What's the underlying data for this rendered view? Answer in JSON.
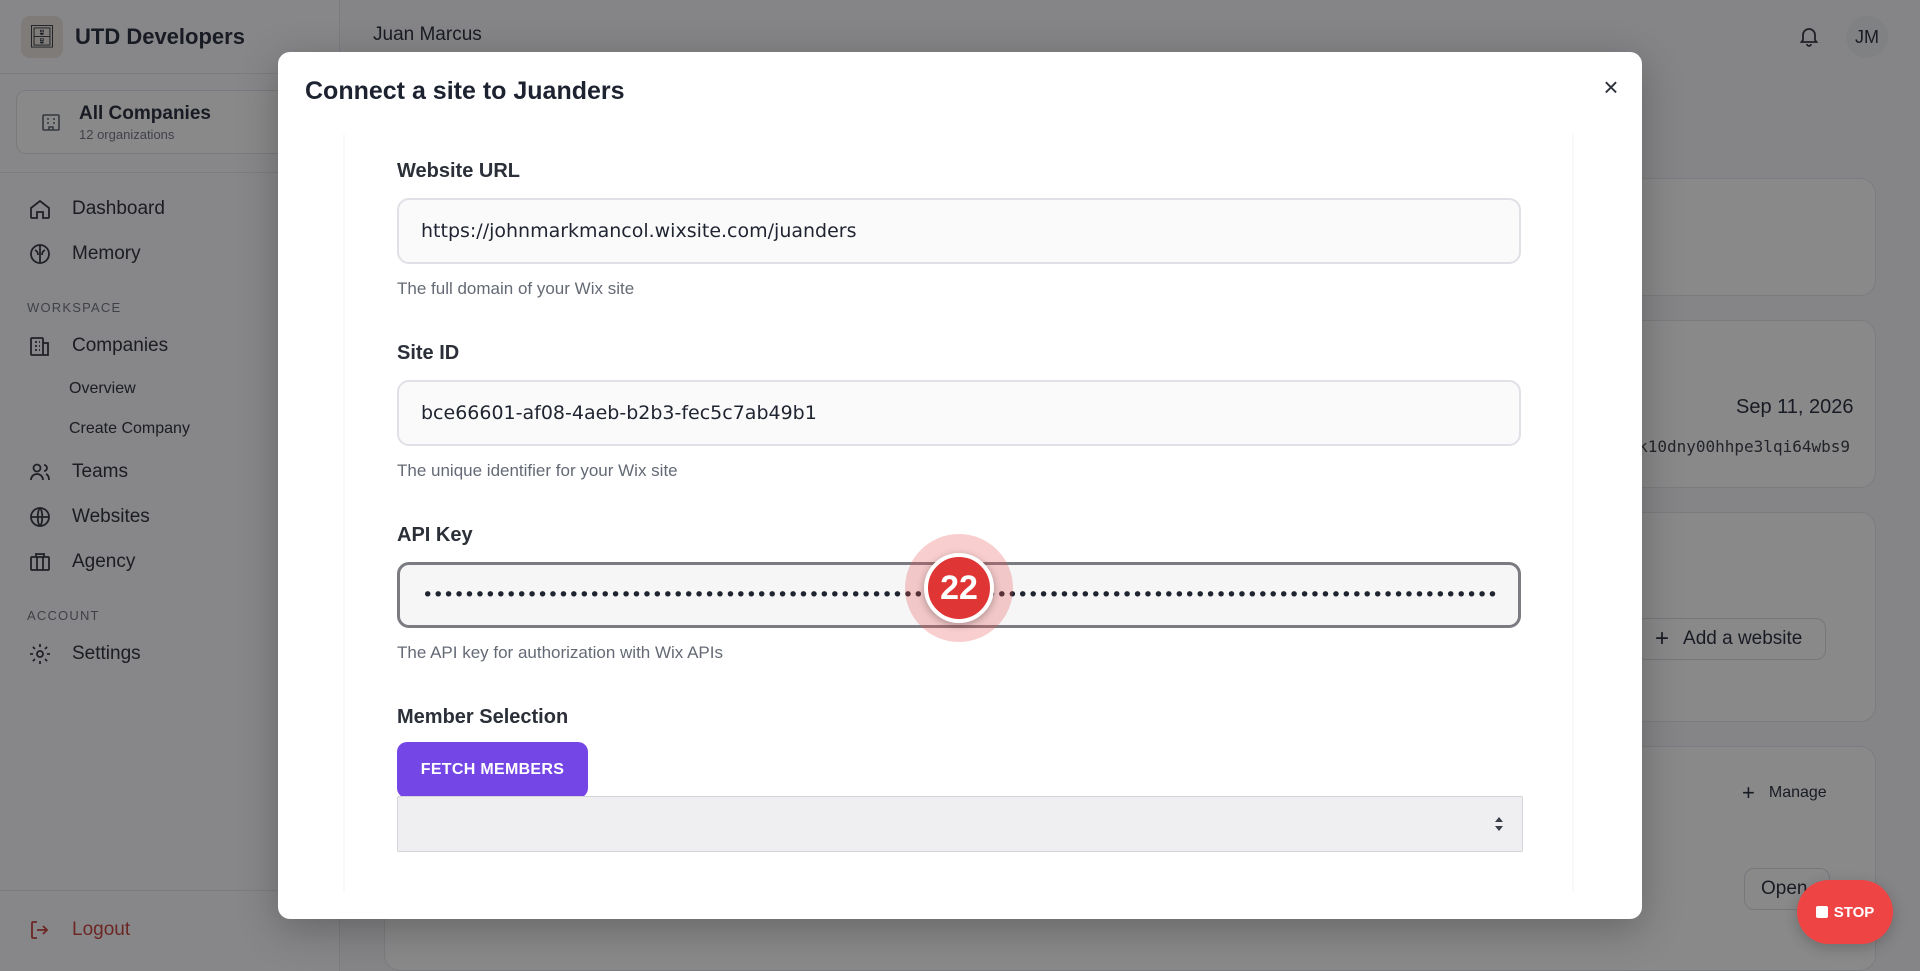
{
  "sidebar": {
    "brand": "UTD Developers",
    "company_switcher": {
      "title": "All Companies",
      "subtitle": "12 organizations"
    },
    "items": {
      "dashboard": "Dashboard",
      "memory": "Memory",
      "workspace_section": "WORKSPACE",
      "companies": "Companies",
      "overview": "Overview",
      "create_company": "Create Company",
      "teams": "Teams",
      "websites": "Websites",
      "agency": "Agency",
      "account_section": "ACCOUNT",
      "settings": "Settings",
      "logout": "Logout"
    }
  },
  "header": {
    "user_name": "Juan Marcus",
    "avatar_initials": "JM"
  },
  "background": {
    "date": "Sep 11, 2026",
    "key_snippet": "k10dny00hhpe3lqi64wbs9",
    "add_website": "Add a website",
    "manage": "Manage",
    "open": "Open"
  },
  "modal": {
    "title": "Connect a site to Juanders",
    "website_url": {
      "label": "Website URL",
      "value": "https://johnmarkmancol.wixsite.com/juanders",
      "help": "The full domain of your Wix site"
    },
    "site_id": {
      "label": "Site ID",
      "value": "bce66601-af08-4aeb-b2b3-fec5c7ab49b1",
      "help": "The unique identifier for your Wix site"
    },
    "api_key": {
      "label": "API Key",
      "value": "••••••••••••••••••••••••••••••••••••••••••••••••••••••••••••••••••••••••••••••••••••••••••••••••••••••••••••••••••••••••••••••••••••••••••••••••••",
      "help": "The API key for authorization with Wix APIs"
    },
    "member_selection": {
      "label": "Member Selection",
      "fetch_button": "FETCH MEMBERS"
    }
  },
  "overlay": {
    "step_number": "22",
    "stop_label": "STOP"
  }
}
